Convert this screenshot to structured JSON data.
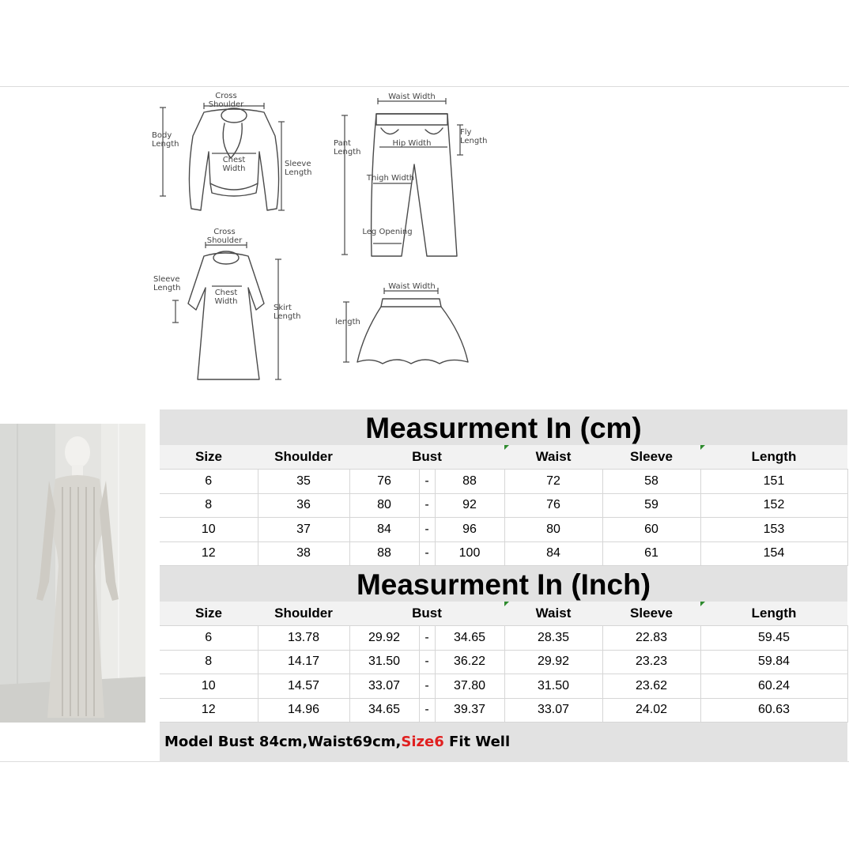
{
  "diagrams": {
    "sweater": {
      "cross_shoulder": "Cross\nShoulder",
      "body_length": "Body\nLength",
      "chest_width": "Chest\nWidth",
      "sleeve_length": "Sleeve\nLength"
    },
    "pants": {
      "waist_width": "Waist Width",
      "pant_length": "Pant\nLength",
      "fly_length": "Fly\nLength",
      "hip_width": "Hip Width",
      "thigh_width": "Thigh Width",
      "leg_opening": "Leg Opening"
    },
    "dress": {
      "cross_shoulder": "Cross\nShoulder",
      "sleeve_length": "Sleeve\nLength",
      "chest_width": "Chest\nWidth",
      "skirt_length": "Skirt\nLength"
    },
    "skirt": {
      "waist_width": "Waist Width",
      "length": "length"
    }
  },
  "columns": [
    "Size",
    "Shoulder",
    "Bust",
    "Waist",
    "Sleeve",
    "Length"
  ],
  "table_cm": {
    "title": "Measurment In (cm)",
    "rows": [
      {
        "size": "6",
        "shoulder": "35",
        "bust_min": "76",
        "sep": "-",
        "bust_max": "88",
        "waist": "72",
        "sleeve": "58",
        "length": "151"
      },
      {
        "size": "8",
        "shoulder": "36",
        "bust_min": "80",
        "sep": "-",
        "bust_max": "92",
        "waist": "76",
        "sleeve": "59",
        "length": "152"
      },
      {
        "size": "10",
        "shoulder": "37",
        "bust_min": "84",
        "sep": "-",
        "bust_max": "96",
        "waist": "80",
        "sleeve": "60",
        "length": "153"
      },
      {
        "size": "12",
        "shoulder": "38",
        "bust_min": "88",
        "sep": "-",
        "bust_max": "100",
        "waist": "84",
        "sleeve": "61",
        "length": "154"
      }
    ]
  },
  "table_inch": {
    "title": "Measurment In (Inch)",
    "rows": [
      {
        "size": "6",
        "shoulder": "13.78",
        "bust_min": "29.92",
        "sep": "-",
        "bust_max": "34.65",
        "waist": "28.35",
        "sleeve": "22.83",
        "length": "59.45"
      },
      {
        "size": "8",
        "shoulder": "14.17",
        "bust_min": "31.50",
        "sep": "-",
        "bust_max": "36.22",
        "waist": "29.92",
        "sleeve": "23.23",
        "length": "59.84"
      },
      {
        "size": "10",
        "shoulder": "14.57",
        "bust_min": "33.07",
        "sep": "-",
        "bust_max": "37.80",
        "waist": "31.50",
        "sleeve": "23.62",
        "length": "60.24"
      },
      {
        "size": "12",
        "shoulder": "14.96",
        "bust_min": "34.65",
        "sep": "-",
        "bust_max": "39.37",
        "waist": "33.07",
        "sleeve": "24.02",
        "length": "60.63"
      }
    ]
  },
  "footnote": {
    "before": "Model Bust 84cm,Waist69cm,",
    "highlight": "Size6",
    "after": " Fit Well",
    "highlight_color": "#e02020"
  }
}
